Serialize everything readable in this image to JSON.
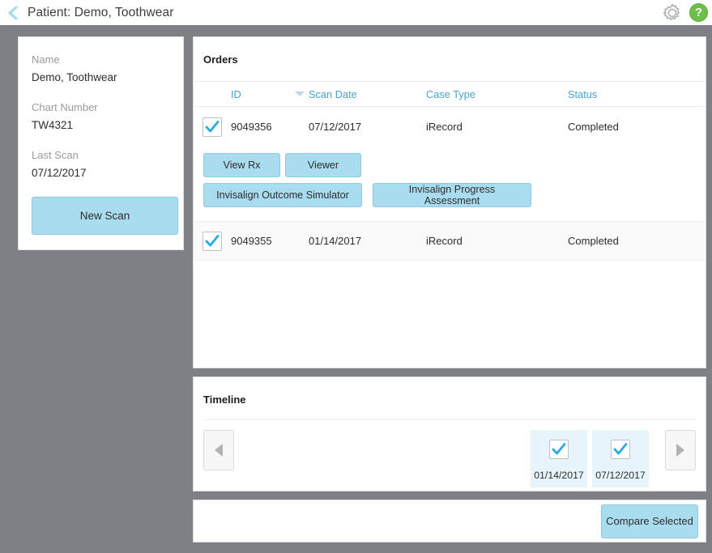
{
  "header": {
    "back_icon": "back-chevron-icon",
    "title": "Patient: Demo, Toothwear",
    "settings_icon": "gear-icon",
    "help_icon": "help-icon",
    "help_glyph": "?",
    "accent_color": "#aadcf0",
    "link_color": "#4aa3c8",
    "help_color": "#6cc04a",
    "page_background": "#7f8083"
  },
  "patient_card": {
    "name_label": "Name",
    "name_value": "Demo, Toothwear",
    "chart_label": "Chart Number",
    "chart_value": "TW4321",
    "last_scan_label": "Last Scan",
    "last_scan_value": "07/12/2017",
    "new_scan_label": "New Scan"
  },
  "orders": {
    "heading": "Orders",
    "columns": {
      "id": "ID",
      "scan_date": "Scan Date",
      "case_type": "Case Type",
      "status": "Status"
    },
    "sort_indicator": "sort-descending-caret",
    "rows": [
      {
        "checked": true,
        "id": "9049356",
        "scan_date": "07/12/2017",
        "case_type": "iRecord",
        "status": "Completed"
      },
      {
        "checked": true,
        "id": "9049355",
        "scan_date": "01/14/2017",
        "case_type": "iRecord",
        "status": "Completed"
      }
    ],
    "actions": {
      "view_rx": "View Rx",
      "viewer": "Viewer",
      "outcome_simulator": "Invisalign Outcome Simulator",
      "progress_assessment": "Invisalign Progress Assessment"
    }
  },
  "timeline": {
    "heading": "Timeline",
    "prev_icon": "arrow-left-icon",
    "next_icon": "arrow-right-icon",
    "items": [
      {
        "date": "01/14/2017",
        "checked": true
      },
      {
        "date": "07/12/2017",
        "checked": true
      }
    ]
  },
  "compare_bar": {
    "compare_label": "Compare Selected"
  }
}
